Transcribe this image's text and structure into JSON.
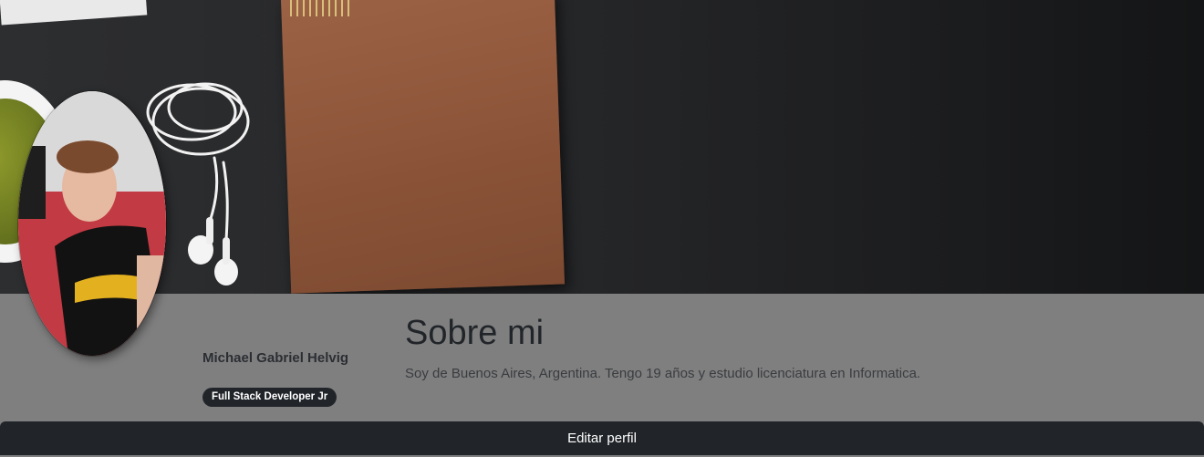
{
  "profile": {
    "name": "Michael Gabriel Helvig",
    "role": "Full Stack Developer Jr"
  },
  "about": {
    "title": "Sobre mi",
    "text": "Soy de Buenos Aires, Argentina. Tengo 19 años y estudio licenciatura en Informatica."
  },
  "actions": {
    "edit_label": "Editar perfil"
  },
  "colors": {
    "info_band": "#7f7f7f",
    "dark": "#212529",
    "notebook": "#8d5539"
  }
}
